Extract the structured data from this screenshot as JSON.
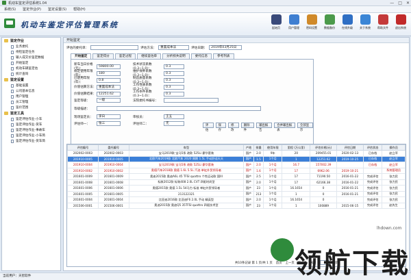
{
  "window": {
    "title": "机动车鉴定评估系统1.04"
  },
  "menu": [
    "系统(S)",
    "鉴定作业(P)",
    "鉴定设置(S)",
    "帮助(H)"
  ],
  "header": {
    "app_title": "机动车鉴定评估管理系统"
  },
  "toolbar": [
    {
      "label": "起始页",
      "color": "#3a4a7a"
    },
    {
      "label": "用户管理",
      "color": "#3f7fd1"
    },
    {
      "label": "密码设置",
      "color": "#d08a2a"
    },
    {
      "label": "数据备份",
      "color": "#4b9a4b"
    },
    {
      "label": "在线升级",
      "color": "#2f6fc4"
    },
    {
      "label": "关于系统",
      "color": "#3b86d6"
    },
    {
      "label": "帮助文件",
      "color": "#c43a3a"
    },
    {
      "label": "退出系统",
      "color": "#c12a2a"
    }
  ],
  "sidebar": {
    "groups": [
      {
        "label": "鉴定作业",
        "items": [
          "业务委托",
          "待检鉴定任务",
          "输入成交价鉴定数据",
          "开始鉴定",
          "机动车辆鉴定估",
          "统计查询"
        ]
      },
      {
        "label": "鉴定设置",
        "items": [
          "基础设置",
          "公司基本信息",
          "用户管理",
          "员工管理",
          "鉴价范围"
        ]
      },
      {
        "label": "鉴定工具",
        "items": [
          "鉴定评估作业-小车",
          "鉴定评估作业-货车",
          "鉴定评估作业-事故车",
          "鉴定评估作业-小车简",
          "鉴定评估作业-货车简"
        ]
      }
    ]
  },
  "content": {
    "panel_title": "开始鉴定",
    "filter": {
      "task_label": "评估的委托单：",
      "method_label": "评估方法：",
      "method_value": "重置成本法",
      "date_label": "评估日期：",
      "date_value": "2019年03月25日"
    },
    "tabs": [
      "开始鉴定",
      "鉴定得分",
      "鉴定过程",
      "继续鉴估单",
      "分析损失说明",
      "委托信息",
      "参考列表"
    ],
    "form": {
      "rows": [
        {
          "label": "新车当日价格 (元)：",
          "value": "59800.00",
          "label2": "技术状况系数(0.3~1.0)：",
          "value2": "0.3"
        },
        {
          "label": "规定使用年限(年)：",
          "value": "180",
          "label2": "维护保养系数(0.3~1.0)：",
          "value2": "0.3"
        },
        {
          "label": "已使用年限 (年)：",
          "value": "0.8",
          "label2": "制造质量系数(0.3~1.0)：",
          "value2": "0.3"
        },
        {
          "label": "价值估算方法：",
          "value": "重置成本法",
          "label2": "工作性质系数(0.3~1.0)：",
          "value2": "0.3"
        },
        {
          "label": "价值估算结果：",
          "value": "12251.62",
          "label2": "工作条件系数(0.3~1.0)：",
          "value2": "0.3"
        },
        {
          "label": "鉴定等级：",
          "value": "一级",
          "label2": "法院委托书编号：",
          "value2": ""
        },
        {
          "label": "等级描述：",
          "value": "",
          "label2": "",
          "value2": ""
        },
        {
          "label": "现场鉴定员：",
          "value": "李白",
          "label2": "审核员：",
          "value2": "王五"
        },
        {
          "label": "评估师一：",
          "value": "张三",
          "label2": "评估师二：",
          "value2": "无"
        }
      ],
      "buttons": [
        "评估",
        "保存",
        "修改",
        "删除件",
        "输出报告",
        "合并输出报表",
        "全部显示"
      ]
    },
    "table": {
      "headers": [
        "评估编号",
        "委托编号",
        "车型",
        "产地",
        "排量",
        "使用年限",
        "里程 (万公里)",
        "评估价格(元)",
        "评估日期",
        "评估状态",
        "操作员"
      ],
      "rows": [
        [
          "202002-0003",
          "202002-0003",
          "宝马2019款 宝马5系 改款 525Li 豪华套装",
          "国产",
          "2.0",
          "9年",
          "20",
          "209455.01",
          "2020-02-13",
          "已存档",
          "赵立军"
        ],
        [
          "201910-0005",
          "201910-0005",
          "北欧汽车2019款 北欧汽车 2020 周期 1.5L 手动舒适天天",
          "国产",
          "1.5",
          "1个月",
          "1",
          "12251.62",
          "2019-10-25",
          "已存档",
          "赵立军"
        ],
        [
          "201910-0004",
          "201910-0004",
          "宝马2019款 宝马5系 改款 525Li 豪华套装",
          "国产",
          "2.0",
          "1个月",
          "16.7",
          "157002.39",
          "",
          "已存档",
          "赵立军"
        ],
        [
          "201910-0002",
          "201910-0002",
          "奥德汽车2018款 奥德 1.6L 5.5L 汽油 单缸外贸领导者",
          "国产",
          "1.6",
          "1个月",
          "17",
          "6962.06",
          "2019-10-21",
          "",
          "系统管理员"
        ],
        [
          "201601-0009",
          "201601-0009",
          "奥迪2015款 奥迪A6L 45 TFSI quattro 个性运动款 国III",
          "国产",
          "2.5",
          "1个月",
          "17",
          "71190.50",
          "2016-01-22",
          "完成评估",
          "张力民"
        ],
        [
          "201601-0008",
          "201601-0008",
          "标致2012款 标致408 2.0L CVT 四驱时尚型",
          "国产",
          "2.0",
          "1个月",
          "17",
          "62166.38",
          "2016-01-22",
          "完成评估",
          "张力民"
        ],
        [
          "201601-0006",
          "201601-0006",
          "奥德2015款 奥德 1.5L 54马力 标准 单缸外贸领导者",
          "国产",
          "23",
          "1个月",
          "16.1654",
          "0",
          "2016-01-21",
          "完成评估",
          "张力民"
        ],
        [
          "201601-0005",
          "201601-0005",
          "213122321",
          "国产",
          "213",
          "1个月",
          "1",
          "0",
          "2016-01-21",
          "完成评估",
          "张力民"
        ],
        [
          "201601-0004",
          "201601-0004",
          "比亚迪2016款 比亚迪F6 2.0L 手动 精英型",
          "国产",
          "2.0",
          "1个月",
          "16.1654",
          "0",
          "",
          "完成评估",
          "张力民"
        ],
        [
          "201506-0001",
          "201506-0001",
          "奥迪2015款 奥迪Q5 35TFSI quattro 四驱技术型",
          "国产",
          "23",
          "1个月",
          "1",
          "100889",
          "2015-06-15",
          "完成评估",
          "赵先生"
        ]
      ]
    },
    "pager": {
      "summary": "共10条记录 第 1 页/共 1 页",
      "first": "首页",
      "prev": "上一页",
      "next": "下一页",
      "last": "末页",
      "jump": "跳转"
    }
  },
  "status": {
    "user": "当前用户：天智软件"
  },
  "watermark": {
    "text": "领航下载",
    "url": "lhdown.com"
  }
}
